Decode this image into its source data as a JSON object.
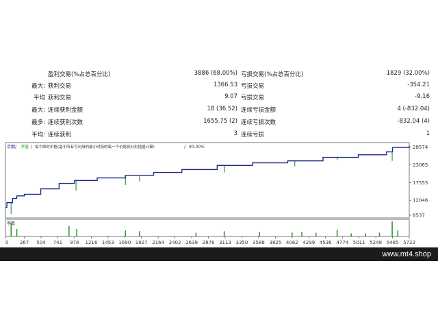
{
  "stats": {
    "rows": [
      {
        "label_a": "",
        "text_a": "盈利交易(%占总百分比)",
        "value_a": "3886 (68.00%)",
        "text_b": "亏损交易(%占总百分比)",
        "value_b": "1829 (32.00%)"
      },
      {
        "label_a": "最大:",
        "text_a": "获利交易",
        "value_a": "1366.53",
        "text_b": "亏损交易",
        "value_b": "-354.21"
      },
      {
        "label_a": "平均",
        "text_a": "获利交易",
        "value_a": "9.07",
        "text_b": "亏损交易",
        "value_b": "-9.16"
      },
      {
        "label_a": "最大:",
        "text_a": "连续获利金额",
        "value_a": "18 (36.52)",
        "text_b": "连续亏损金额",
        "value_b": "4 (-832.04)"
      },
      {
        "label_a": "最多:",
        "text_a": "连续获利次数",
        "value_a": "1655.75 (2)",
        "text_b": "连续亏损次数",
        "value_b": "-832.04 (4)"
      },
      {
        "label_a": "平均:",
        "text_a": "连续获利",
        "value_a": "3",
        "text_b": "连续亏损",
        "value_b": "1"
      }
    ]
  },
  "chart": {
    "header": {
      "balance": "余额",
      "equity": "净值",
      "description": "每个即时价格(基于所有可利用的最小时段的每一个价格到分形插值计算)",
      "quality": "90.00%"
    },
    "volume_label": "手数",
    "colors": {
      "balance": "#1f2a86",
      "equity": "#2d9f2d",
      "volume": "#2e9a2e",
      "axis": "#333333",
      "grid": "#cccccc"
    }
  },
  "chart_data": {
    "type": "line",
    "series": [
      {
        "name": "余额",
        "x": [
          0,
          20,
          100,
          160,
          267,
          500,
          760,
          978,
          1300,
          1700,
          2100,
          2500,
          3000,
          3500,
          4000,
          4500,
          5000,
          5400,
          5485,
          5722
        ],
        "values": [
          9800,
          11300,
          12600,
          13400,
          13900,
          15600,
          17300,
          18200,
          19000,
          19800,
          20700,
          21600,
          22900,
          23700,
          24300,
          25400,
          26200,
          27100,
          28500,
          29000
        ]
      }
    ],
    "x_ticks": [
      "0",
      "267",
      "504",
      "741",
      "978",
      "1216",
      "1453",
      "1690",
      "1927",
      "2164",
      "2402",
      "2639",
      "2876",
      "3113",
      "3350",
      "3588",
      "3825",
      "4062",
      "4299",
      "4536",
      "4774",
      "5011",
      "5248",
      "5485",
      "5722"
    ],
    "y_ticks": [
      "28574",
      "23065",
      "17555",
      "12046",
      "6537"
    ],
    "xlim": [
      0,
      5722
    ],
    "ylim": [
      6537,
      30000
    ],
    "equity_dips": [
      [
        80,
        7800
      ],
      [
        1000,
        15000
      ],
      [
        1700,
        16800
      ],
      [
        1900,
        17900
      ],
      [
        3100,
        20700
      ],
      [
        4100,
        22600
      ],
      [
        4700,
        24600
      ],
      [
        5480,
        24300
      ]
    ],
    "volume_spikes": [
      [
        80,
        0.9
      ],
      [
        160,
        0.5
      ],
      [
        900,
        0.7
      ],
      [
        1010,
        0.5
      ],
      [
        1700,
        0.4
      ],
      [
        1900,
        0.35
      ],
      [
        2700,
        0.25
      ],
      [
        3100,
        0.35
      ],
      [
        3600,
        0.3
      ],
      [
        4062,
        0.25
      ],
      [
        4200,
        0.3
      ],
      [
        4400,
        0.25
      ],
      [
        4700,
        0.45
      ],
      [
        4900,
        0.2
      ],
      [
        5100,
        0.2
      ],
      [
        5300,
        0.25
      ],
      [
        5480,
        1.0
      ],
      [
        5560,
        0.4
      ]
    ]
  }
}
